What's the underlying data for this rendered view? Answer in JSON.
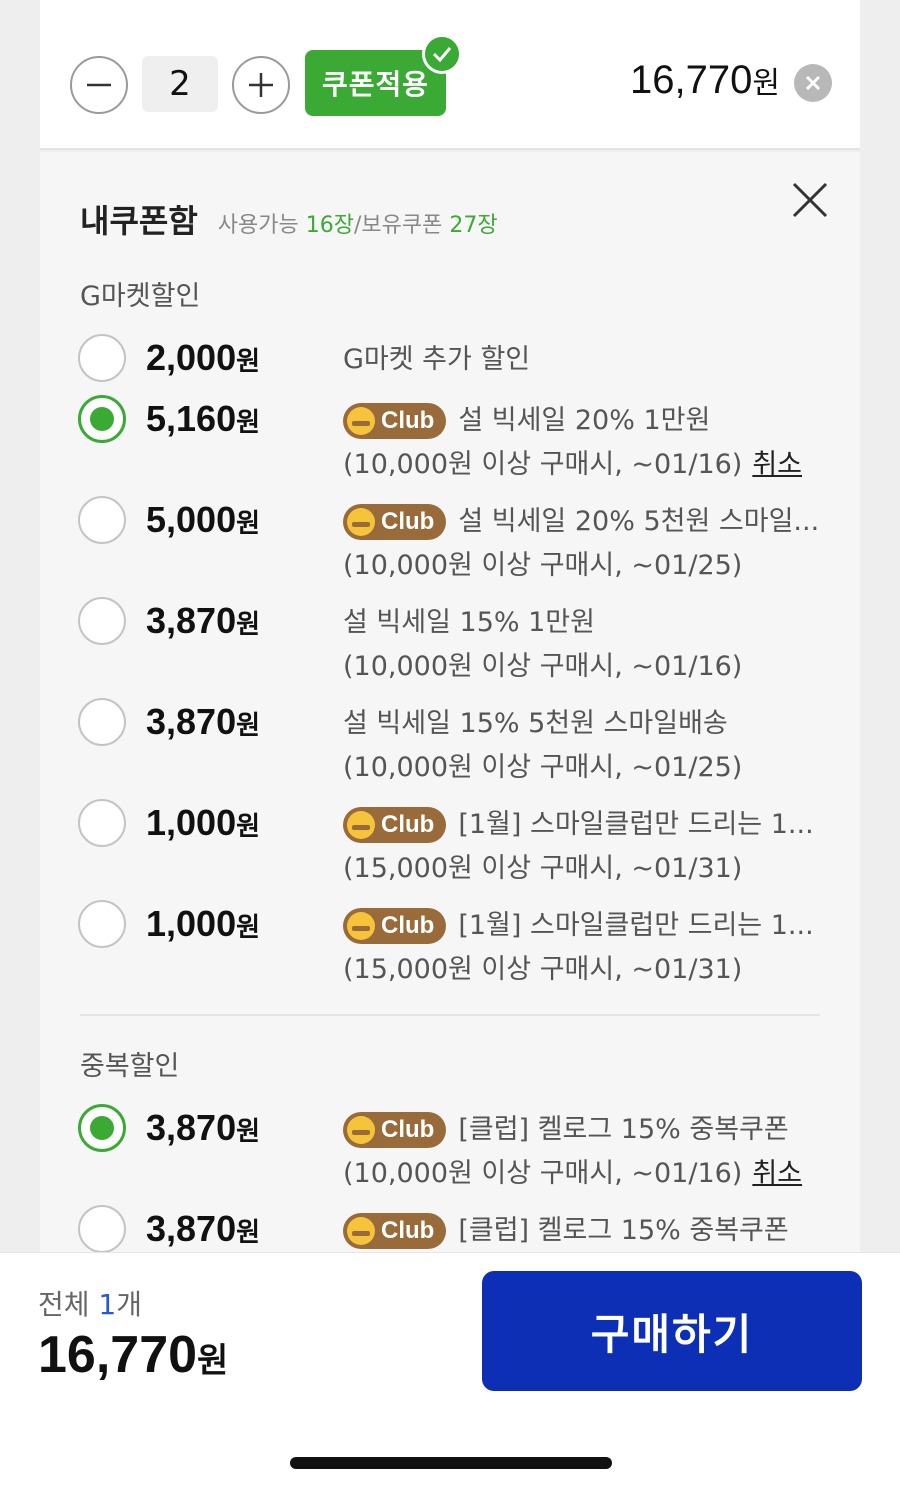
{
  "product": {
    "quantity": "2",
    "coupon_button_label": "쿠폰적용",
    "price_value": "16,770",
    "price_unit": "원"
  },
  "coupon_panel": {
    "title": "내쿠폰함",
    "subtitle_prefix": "사용가능 ",
    "available_count": "16장",
    "subtitle_mid": "/보유쿠폰 ",
    "owned_count": "27장",
    "sections": [
      {
        "label": "G마켓할인",
        "items": [
          {
            "amount": "2,000",
            "unit": "원",
            "selected": false,
            "club": false,
            "line1": "G마켓 추가 할인",
            "line2": "",
            "cancel": ""
          },
          {
            "amount": "5,160",
            "unit": "원",
            "selected": true,
            "club": true,
            "club_label": "Club",
            "line1": "설 빅세일 20% 1만원",
            "line2": "(10,000원 이상 구매시, ~01/16)",
            "cancel": "취소"
          },
          {
            "amount": "5,000",
            "unit": "원",
            "selected": false,
            "club": true,
            "club_label": "Club",
            "line1": "설 빅세일 20% 5천원 스마일...",
            "line2": "(10,000원 이상 구매시, ~01/25)",
            "cancel": ""
          },
          {
            "amount": "3,870",
            "unit": "원",
            "selected": false,
            "club": false,
            "line1": "설 빅세일 15% 1만원",
            "line2": "(10,000원 이상 구매시, ~01/16)",
            "cancel": ""
          },
          {
            "amount": "3,870",
            "unit": "원",
            "selected": false,
            "club": false,
            "line1": "설 빅세일 15% 5천원 스마일배송",
            "line2": "(10,000원 이상 구매시, ~01/25)",
            "cancel": ""
          },
          {
            "amount": "1,000",
            "unit": "원",
            "selected": false,
            "club": true,
            "club_label": "Club",
            "line1": "[1월] 스마일클럽만 드리는 1...",
            "line2": "(15,000원 이상 구매시, ~01/31)",
            "cancel": ""
          },
          {
            "amount": "1,000",
            "unit": "원",
            "selected": false,
            "club": true,
            "club_label": "Club",
            "line1": "[1월] 스마일클럽만 드리는 1...",
            "line2": "(15,000원 이상 구매시, ~01/31)",
            "cancel": ""
          }
        ]
      },
      {
        "label": "중복할인",
        "items": [
          {
            "amount": "3,870",
            "unit": "원",
            "selected": true,
            "club": true,
            "club_label": "Club",
            "line1": "[클럽] 켈로그 15% 중복쿠폰",
            "line2": "(10,000원 이상 구매시, ~01/16)",
            "cancel": "취소"
          },
          {
            "amount": "3,870",
            "unit": "원",
            "selected": false,
            "club": true,
            "club_label": "Club",
            "line1": "[클럽] 켈로그 15% 중복쿠폰",
            "line2": "",
            "cancel": ""
          }
        ]
      }
    ]
  },
  "footer": {
    "total_label": "전체 ",
    "total_count": "1",
    "total_count_unit": "개",
    "total_price": "16,770",
    "total_unit": "원",
    "buy_label": "구매하기"
  },
  "colors": {
    "green": "#3aaa35",
    "club_brown": "#9a6b3a",
    "buy_blue": "#0c2fb5",
    "count_blue": "#2a57d6"
  }
}
